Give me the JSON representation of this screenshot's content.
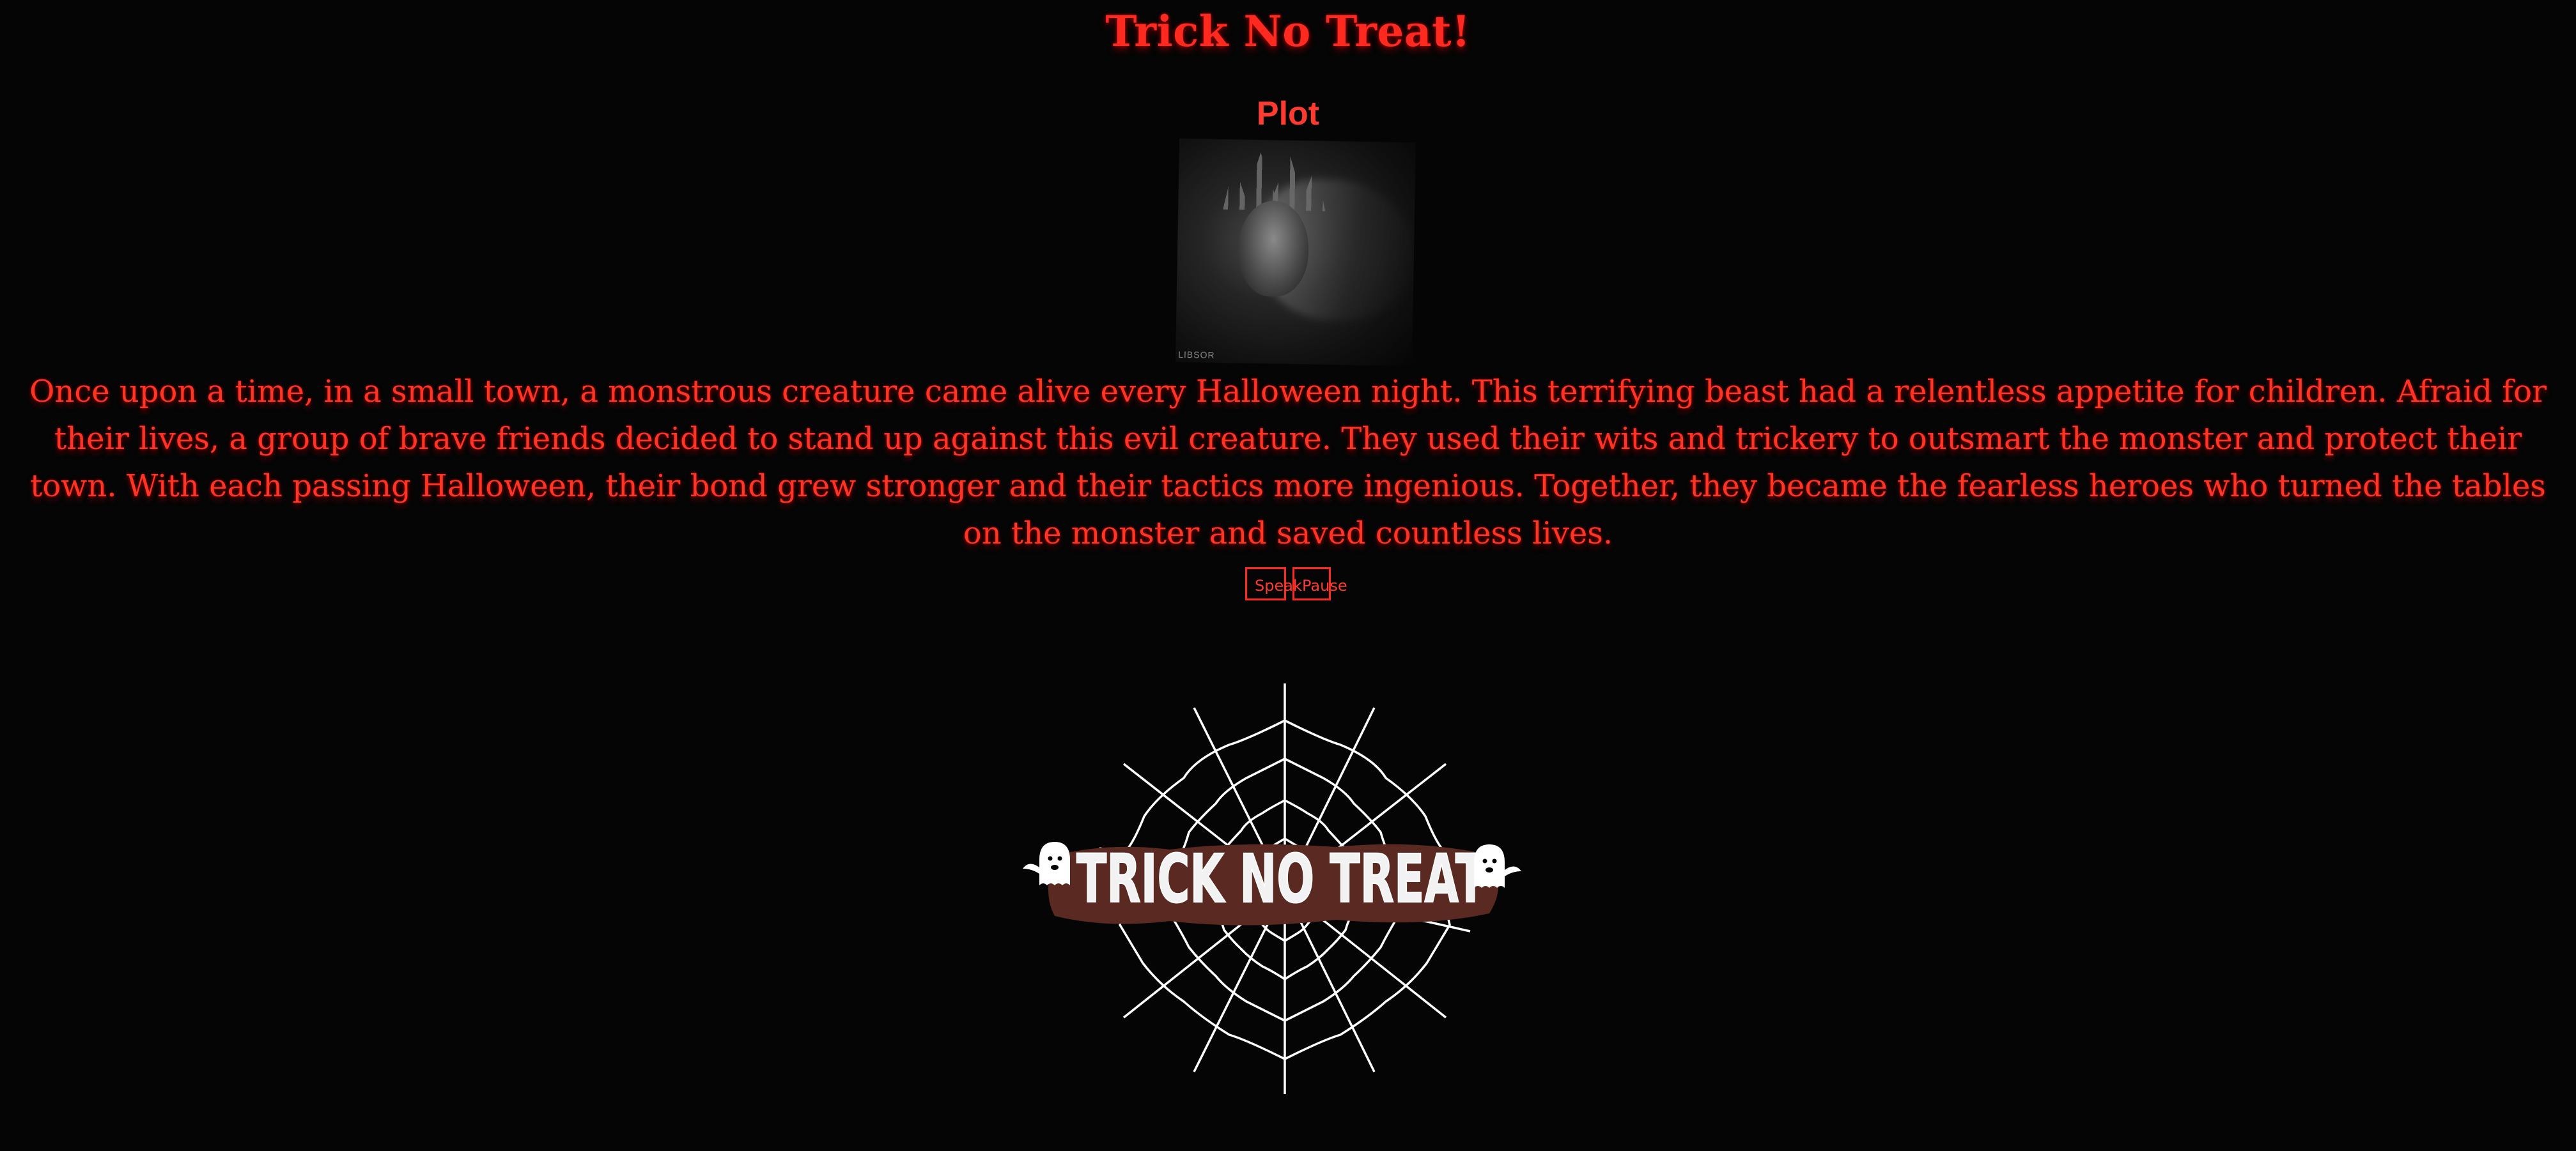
{
  "page": {
    "title": "Trick No Treat!",
    "subtitle": "Plot"
  },
  "plot_image": {
    "alt": "",
    "watermark": "LIBSOR"
  },
  "story": {
    "text": "Once upon a time, in a small town, a monstrous creature came alive every Halloween night. This terrifying beast had a relentless appetite for children. Afraid for their lives, a group of brave friends decided to stand up against this evil creature. They used their wits and trickery to outsmart the monster and protect their town. With each passing Halloween, their bond grew stronger and their tactics more ingenious. Together, they became the fearless heroes who turned the tables on the monster and saved countless lives."
  },
  "controls": {
    "speak_label": "Speak",
    "pause_label": "Pause"
  },
  "logo": {
    "text": "TRICK NO TREAT",
    "icons": [
      "spider-web-icon",
      "ghost-icon"
    ]
  },
  "colors": {
    "background": "#050505",
    "accent": "#ff2a1f",
    "logo_text": "#f2f2f2",
    "logo_shadow": "#5a2a22"
  }
}
